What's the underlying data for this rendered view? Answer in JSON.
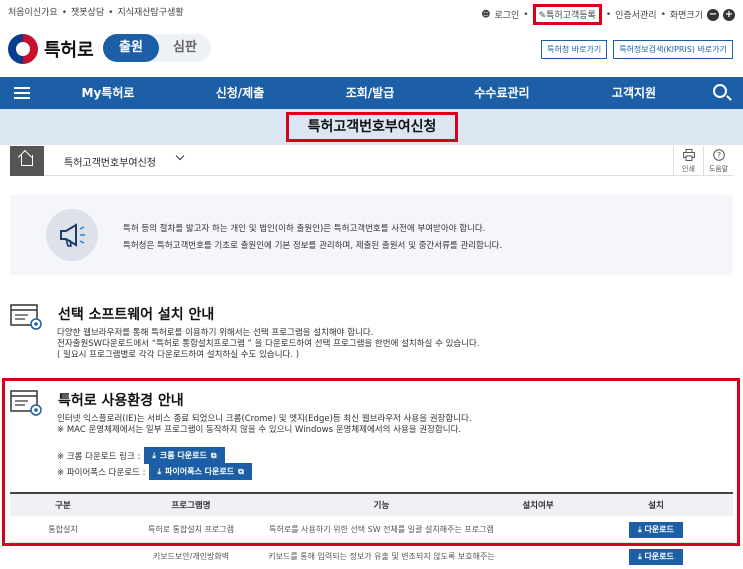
{
  "topbar": {
    "links": [
      "처음이신가요",
      "챗봇상담",
      "지식재산탐구생활"
    ],
    "login": "로그인",
    "register_customer_no": "특허고객등록",
    "cert_manage": "인증서관리",
    "screen_size": "화면크기",
    "zoom_out": "−",
    "zoom_in": "+"
  },
  "header": {
    "logo": "특허로",
    "tab_active": "출원",
    "tab_inactive": "심판",
    "link1": "특허청 바로가기",
    "link2": "특허정보검색(KIPRIS) 바로가기"
  },
  "nav": {
    "items": [
      "My특허로",
      "신청/제출",
      "조회/발급",
      "수수료관리",
      "고객지원"
    ]
  },
  "banner": {
    "title": "특허고객번호부여신청"
  },
  "breadcrumb": {
    "current": "특허고객번호부여신청",
    "print": "인쇄",
    "help": "도움말"
  },
  "info": {
    "line1": "특허 등의 절차를 밟고자 하는 개인 및 법인(이하 출원인)은 특허고객번호를 사전에 부여받아야 합니다.",
    "line2": "특허청은 특허고객번호를 기초로 출원인에 기본 정보를 관리하며, 제출된 출원서 및 중간서류를 관리합니다."
  },
  "section1": {
    "title": "선택 소프트웨어 설치 안내",
    "line1": "다양한 웹브라우저를 통해 특허로를 이용하기 위해서는 선택 프로그램을 설치해야 합니다.",
    "line2": "전자출원SW다운로드에서 “특허로 통합설치프로그램 ” 을 다운로드하여 선택 프로그램을 한번에 설치하실 수 있습니다.",
    "line3": "( 필요시 프로그램별로 각각 다운로드하여 설치하실 수도 있습니다. )"
  },
  "section2": {
    "title": "특허로 사용환경 안내",
    "line1": "인터넷 익스플로러(IE)는 서비스 종료 되었으니 크롬(Crome) 및 엣지(Edge)등 최신 웹브라우저 사용을 권장합니다.",
    "line2": "※ MAC 운영체제에서는 일부 프로그램이 동작하지 않을 수 있으니 Windows 운영체제에서의 사용을 권장합니다.",
    "chrome_label": "※ 크롬 다운로드 링크 :",
    "chrome_btn": "크롬 다운로드",
    "firefox_label": "※ 파이어폭스 다운로드 :",
    "firefox_btn": "파이어폭스 다운로드"
  },
  "table": {
    "headers": [
      "구분",
      "프로그램명",
      "기능",
      "설치여부",
      "설치"
    ],
    "rows": [
      {
        "category": "통합설치",
        "program": "특허로 통합설치 프로그램",
        "function": "특허로를 사용하기 위한 선택 SW 전체를 일괄 설치해주는 프로그램",
        "installed": "",
        "button": "다운로드"
      },
      {
        "category": "",
        "program": "키보드보안/개인방화벽",
        "function": "키보드를 통해 입력되는 정보가 유출 및 변조되지 않도록 보호해주는 프로그램",
        "installed": "",
        "button": "다운로드"
      }
    ]
  },
  "colors": {
    "primary": "#1d5fa6",
    "highlight": "#d9001b",
    "banner_bg": "#dce6f2"
  }
}
